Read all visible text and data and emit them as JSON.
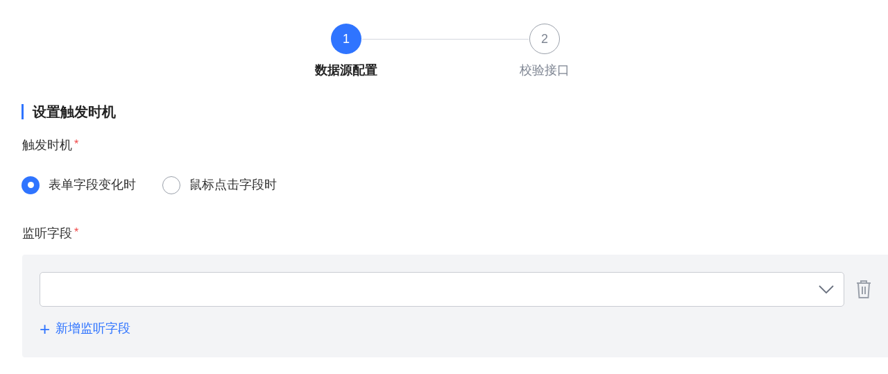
{
  "steps": [
    {
      "number": "1",
      "label": "数据源配置",
      "selected": true
    },
    {
      "number": "2",
      "label": "校验接口",
      "selected": false
    }
  ],
  "section": {
    "title": "设置触发时机"
  },
  "trigger": {
    "label": "触发时机",
    "required_mark": "*",
    "options": [
      {
        "label": "表单字段变化时",
        "selected": true
      },
      {
        "label": "鼠标点击字段时",
        "selected": false
      }
    ]
  },
  "listen": {
    "label": "监听字段",
    "required_mark": "*",
    "fields": [
      {
        "kind": "select"
      }
    ],
    "add_link": {
      "icon": "+",
      "label": "新增监听字段"
    }
  }
}
